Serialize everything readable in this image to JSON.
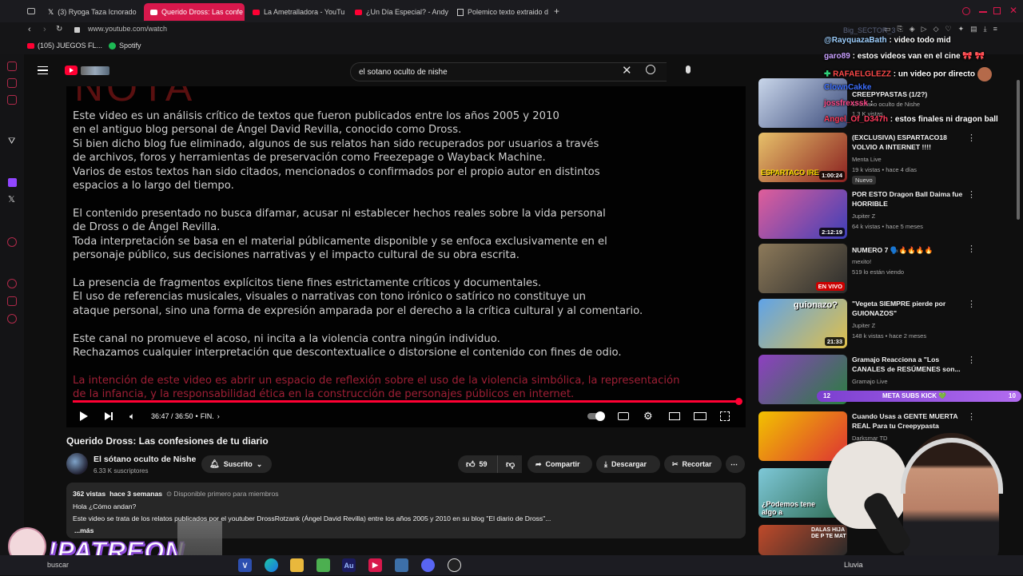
{
  "browser": {
    "tabs": [
      {
        "label": "(3) Ryoga Taza Icnorado",
        "active": false
      },
      {
        "label": "Querido Dross: Las confe",
        "active": true
      },
      {
        "label": "La Ametralladora - YouTu",
        "active": false
      },
      {
        "label": "¿Un Día Especial? - Andy",
        "active": false
      },
      {
        "label": "Polemico texto extraido d",
        "active": false
      }
    ],
    "url": "www.youtube.com/watch",
    "bookmarks": [
      {
        "label": "(105) JUEGOS FL..."
      },
      {
        "label": "Spotify"
      }
    ]
  },
  "youtube": {
    "search_query": "el sotano oculto de nishe"
  },
  "video": {
    "watermark": "NOTA",
    "paragraphs": [
      "Este video es un análisis crítico de textos que fueron publicados entre los años 2005 y 2010\nen el antiguo blog personal de Ángel David Revilla, conocido como Dross.\nSi bien dicho blog fue eliminado, algunos de sus relatos han sido recuperados por usuarios a través\nde archivos, foros y herramientas de preservación como Freezepage o Wayback Machine.\nVarios de estos textos han sido citados, mencionados o confirmados por el propio autor en distintos\nespacios a lo largo del tiempo.",
      "El contenido presentado no busca difamar, acusar ni establecer hechos reales sobre la vida personal\nde Dross o de Ángel Revilla.\nToda interpretación se basa en el material públicamente disponible y se enfoca exclusivamente en el\npersonaje público, sus decisiones narrativas y el impacto cultural de su obra escrita.",
      "La presencia de fragmentos explícitos tiene fines estrictamente críticos y documentales.\nEl uso de referencias musicales, visuales o narrativas con tono irónico o satírico no constituye un\nataque personal, sino una forma de expresión amparada por el derecho a la crítica cultural y al comentario.",
      "Este canal no promueve el acoso, ni incita a la violencia contra ningún individuo.\nRechazamos cualquier interpretación que descontextualice o distorsione el contenido con fines de odio.",
      "La intención de este video es abrir un espacio de reflexión sobre el uso de la violencia simbólica, la representación\nde la infancia, y la responsabilidad ética en la construcción de personajes públicos en internet."
    ],
    "time": "36:47 / 36:50",
    "chapter": "FIN.",
    "progress": 0.9986,
    "title": "Querido Dross: Las confesiones de tu diario",
    "channel": "El sótano oculto de Nishe",
    "subscribers": "6.33 K suscriptores",
    "subscribed_label": "Suscrito",
    "likes": "59",
    "share_label": "Compartir",
    "download_label": "Descargar",
    "clip_label": "Recortar",
    "views": "362 vistas",
    "published": "hace 3 semanas",
    "members_note": "Disponible primero para miembros",
    "desc_line1": "Hola ¿Cómo andan?",
    "desc_line2": "Este video se trata de los relatos publicados por el youtuber DrossRotzank (Ángel David Revilla) entre los años 2005 y 2010 en su blog \"El diario de Dross\"...",
    "more_label": "...más"
  },
  "recommendations": [
    {
      "title": "CREEPYPASTAS (1/2?)",
      "channel": "El sótano oculto de Nishe",
      "meta": "1.3 K vistas",
      "duration": "",
      "badge": "",
      "colors": [
        "#c9d6ea",
        "#3a4a7a"
      ]
    },
    {
      "title": "(EXCLUSIVA) ESPARTACO18 VOLVIO A INTERNET !!!!",
      "channel": "Menta Live",
      "meta": "19 k vistas • hace 4 días",
      "duration": "1:00:24",
      "badge": "Nuevo",
      "colors": [
        "#e7c16a",
        "#8a2020"
      ]
    },
    {
      "title": "POR ESTO Dragon Ball Daima fue HORRIBLE",
      "channel": "Jupiter Z",
      "meta": "64 k vistas • hace 5 meses",
      "duration": "2:12:19",
      "badge": "",
      "colors": [
        "#e05e9a",
        "#3d3fb8"
      ]
    },
    {
      "title": "NUMERO 7 🗣️🔥🔥🔥🔥",
      "channel": "mexito!",
      "meta": "519 lo están viendo",
      "duration": "",
      "badge": "EN VIVO",
      "colors": [
        "#8d7a5a",
        "#2b2b2b"
      ]
    },
    {
      "title": "\"Vegeta SIEMPRE pierde por GUIONAZOS\"",
      "channel": "Jupiter Z",
      "meta": "148 k vistas • hace 2 meses",
      "duration": "21:33",
      "badge": "",
      "colors": [
        "#5fa3e8",
        "#e0c04a"
      ]
    },
    {
      "title": "Gramajo Reacciona a \"Los CANALES de RESÚMENES son...",
      "channel": "Gramajo Live",
      "meta": "",
      "duration": "",
      "badge": "",
      "colors": [
        "#8e3fc1",
        "#2a7f3f"
      ]
    },
    {
      "title": "Cuando Usas a GENTE MUERTA REAL Para tu Creepypasta",
      "channel": "Darksmar TD",
      "meta": "",
      "duration": "",
      "badge": "",
      "colors": [
        "#d33",
        "#f2c200"
      ]
    },
    {
      "title": "",
      "channel": "",
      "meta": "",
      "duration": "",
      "badge": "",
      "colors": [
        "#7ec8d8",
        "#2e6b52"
      ]
    },
    {
      "title": "",
      "channel": "",
      "meta": "",
      "duration": "",
      "badge": "",
      "colors": [
        "#c04a2a",
        "#2a2a2a"
      ]
    }
  ],
  "rec_thumb_texts": {
    "r2": "ESPARTACO IRE",
    "r5": "guionazo?",
    "r8": "¿Podemos tene algo a",
    "r9": "DALAS HIJA DE P TE MAT"
  },
  "chat": [
    {
      "user": "@RayquazaBath",
      "msg": "video todo mid",
      "color": "#9fd0ff"
    },
    {
      "user": "garo89",
      "msg": "estos videos van en el cine 🎀 🎀",
      "color": "#c9a0ff"
    },
    {
      "user": "RAFAELGLEZZ",
      "msg": "un video por directo",
      "color": "#ff4a4a"
    },
    {
      "user": "ClownCakke",
      "msg": "",
      "color": "#3d6fff"
    },
    {
      "user": "jossfrexssk",
      "msg": "",
      "color": "#ff4a8a"
    },
    {
      "user": "Angel_Of_D347h",
      "msg": "estos finales ni dragon ball",
      "color": "#ff3b5c"
    }
  ],
  "overlay": {
    "kick_left": "12",
    "kick_label": "META SUBS KICK 💚",
    "kick_right": "10",
    "patreon": "!PATREON"
  },
  "taskbar": {
    "search_label": "buscar",
    "weather": "Lluvia"
  },
  "colors": {
    "youtube_red": "#ff0033",
    "opera_red": "#d8184c",
    "kick_purple": "#9b55e0"
  }
}
